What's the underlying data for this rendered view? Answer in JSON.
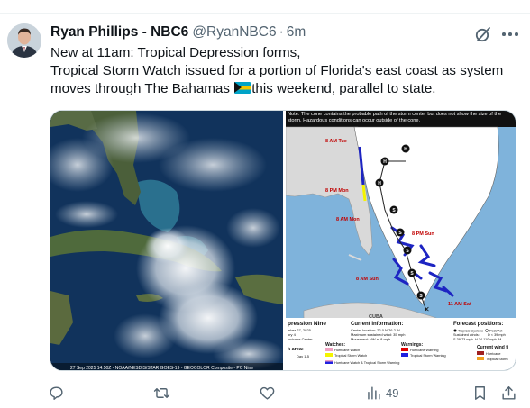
{
  "tweet": {
    "author_name": "Ryan Phillips - NBC6",
    "handle": "@RyanNBC6",
    "separator": "·",
    "time": "6m",
    "text_line1": "New at 11am: Tropical Depression forms,",
    "text_line2": "Tropical Storm Watch issued for a portion of Florida's east coast as system",
    "text_line3_a": "moves through The Bahamas",
    "text_line3_b": "this weekend, parallel to state.",
    "flag_icon": "bahamas-flag-emoji"
  },
  "media": {
    "satellite_caption": "27 Sep 2025 14:50Z - NOAA/NESDIS/STAR GOES-19 - GEOCOLOR Composite - PC Nine",
    "map": {
      "note": "Note: The cone contains the probable path of the storm center but does not show the size of the storm. Hazardous conditions can occur outside of the cone.",
      "track_labels": [
        "8 AM Tue",
        "8 PM Mon",
        "8 AM Mon",
        "8 PM Sun",
        "8 AM Sun",
        "11 AM Sat"
      ],
      "point_markers": [
        "H",
        "H",
        "H",
        "S",
        "S",
        "S",
        "S",
        "S"
      ],
      "country_label": "CUBA",
      "legend": {
        "title": "pression Nine",
        "subtitle_lines": [
          "mber 27, 2025",
          "ory 4",
          "urricane Center"
        ],
        "current_info_title": "Current information:",
        "current_info_lines": [
          "Center location: 22.0 N 76.2 W",
          "Maximum sustained wind: 35 mph",
          "Movement: NW at 8 mph"
        ],
        "forecast_title": "Forecast positions:",
        "forecast_lines": [
          "Tropical Cyclone",
          "Post/Pot",
          "Sustained winds:",
          "D < 39 mph",
          "S 39-73 mph",
          "H 74-110 mph",
          "M"
        ],
        "area_label": "k area:",
        "area_sub": "Day 1-5",
        "watches_title": "Watches:",
        "watches": [
          "Hurricane Watch",
          "Tropical Storm Watch"
        ],
        "warnings_title": "Warnings:",
        "warnings": [
          "Hurricane Warning",
          "Tropical Storm Warning"
        ],
        "combo": "Hurricane Watch & Tropical Storm Warning",
        "wind_title": "Current wind fi",
        "wind_items": [
          "Hurricane",
          "Tropical Storm"
        ]
      }
    }
  },
  "actions": {
    "views_count": "49"
  },
  "colors": {
    "text_primary": "#0f1419",
    "text_secondary": "#536471",
    "border": "#cfd9de",
    "cone_white": "#ffffff",
    "watch_blue": "#1d24c2",
    "ts_warning_blue": "#2020e0",
    "watch_yellow": "#f4f400",
    "ocean": "#7fb3db"
  }
}
